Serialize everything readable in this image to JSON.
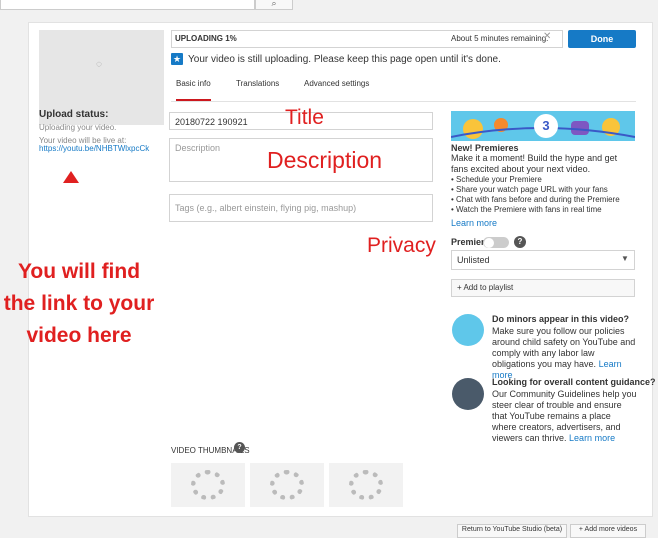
{
  "top": {
    "search_icon": "magnifier-icon"
  },
  "upload_panel": {
    "status_title": "Upload status:",
    "status_sub": "Uploading your video.",
    "live_at": "Your video will be live at:",
    "link": "https://youtu.be/NHBTWlxpcCk"
  },
  "annotations": {
    "title": "Title",
    "description": "Description",
    "privacy": "Privacy",
    "left_note": "You will find the link to your video here",
    "arrow_color": "#e02020"
  },
  "progress": {
    "label": "UPLOADING 1%",
    "percent": 1,
    "remaining": "About 5 minutes remaining.",
    "done_label": "Done"
  },
  "notice": {
    "text": "Your video is still uploading. Please keep this page open until it's done."
  },
  "tabs": [
    "Basic info",
    "Translations",
    "Advanced settings"
  ],
  "form": {
    "title_value": "20180722 190921",
    "description_placeholder": "Description",
    "tags_placeholder": "Tags (e.g., albert einstein, flying pig, mashup)"
  },
  "premieres": {
    "banner_number": "3",
    "title": "New! Premieres",
    "desc": "Make it a moment! Build the hype and get fans excited about your next video.",
    "items": [
      "• Schedule your Premiere",
      "• Share your watch page URL with your fans",
      "• Chat with fans before and during the Premiere",
      "• Watch the Premiere with fans in real time"
    ],
    "learn_more": "Learn more"
  },
  "premiere_toggle": {
    "label": "Premiere",
    "help": "?"
  },
  "privacy_select": {
    "value": "Unlisted"
  },
  "playlist": {
    "label": "+ Add to playlist"
  },
  "minors": {
    "title": "Do minors appear in this video?",
    "body": "Make sure you follow our policies around child safety on YouTube and comply with any labor law obligations you may have.",
    "learn_more": "Learn more"
  },
  "guidance": {
    "title": "Looking for overall content guidance?",
    "body": "Our Community Guidelines help you steer clear of trouble and ensure that YouTube remains a place where creators, advertisers, and viewers can thrive.",
    "learn_more": "Learn more"
  },
  "thumbnails": {
    "label": "VIDEO THUMBNAILS",
    "help": "?"
  },
  "footer": {
    "return_label": "Return to YouTube Studio (beta)",
    "add_more_label": "+ Add more videos"
  },
  "colors": {
    "accent": "#167ac6",
    "annotation_red": "#e02020",
    "tab_underline": "#cc181e"
  }
}
